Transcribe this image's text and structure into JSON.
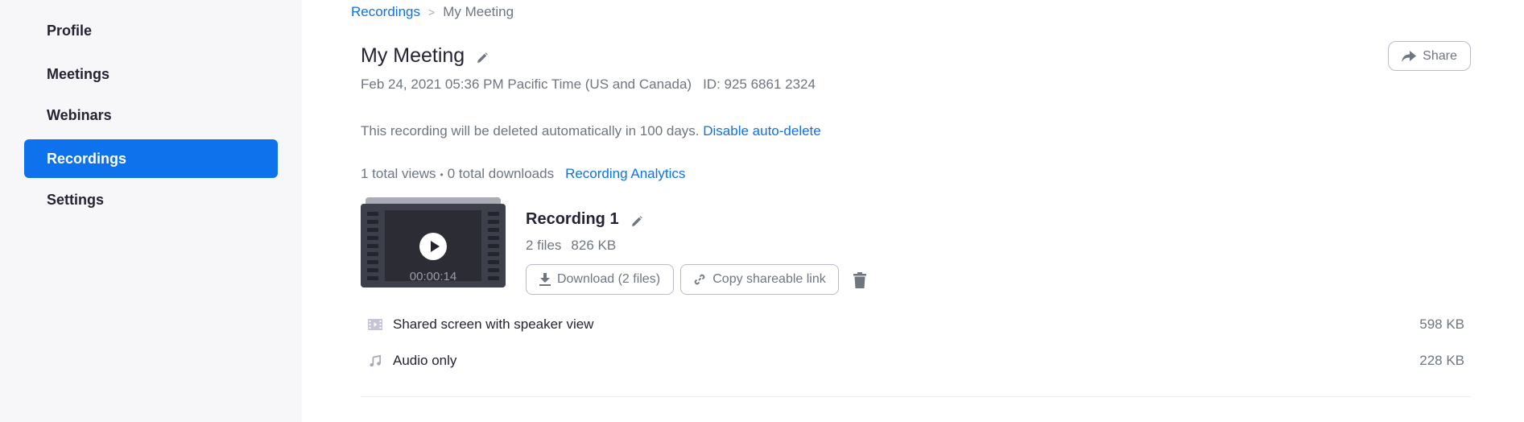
{
  "sidebar": {
    "items": [
      {
        "label": "Profile",
        "active": false
      },
      {
        "label": "Meetings",
        "active": false
      },
      {
        "label": "Webinars",
        "active": false
      },
      {
        "label": "Recordings",
        "active": true
      },
      {
        "label": "Settings",
        "active": false
      }
    ]
  },
  "breadcrumb": {
    "parent": "Recordings",
    "separator": ">",
    "current": "My Meeting"
  },
  "meeting": {
    "title": "My Meeting",
    "datetime": "Feb 24, 2021 05:36 PM Pacific Time (US and Canada)",
    "id_text": "ID: 925 6861 2324",
    "auto_delete_text": "This recording will be deleted automatically in 100 days.",
    "disable_auto_delete_link": "Disable auto-delete",
    "views_text": "1 total views",
    "dot": "•",
    "downloads_text": "0 total downloads",
    "analytics_link": "Recording Analytics"
  },
  "share_button": {
    "label": "Share",
    "icon": "share-arrow-icon"
  },
  "recording": {
    "title": "Recording 1",
    "duration": "00:00:14",
    "file_count": "2 files",
    "total_size": "826 KB",
    "download_label": "Download (2 files)",
    "copy_link_label": "Copy shareable link",
    "files": [
      {
        "name": "Shared screen with speaker view",
        "size": "598 KB",
        "icon": "video-file-icon"
      },
      {
        "name": "Audio only",
        "size": "228 KB",
        "icon": "audio-file-icon"
      }
    ]
  },
  "colors": {
    "accent": "#0e72ed",
    "sidebar_bg": "#f7f7fa",
    "text_primary": "#232333",
    "text_secondary": "#6e7680"
  }
}
